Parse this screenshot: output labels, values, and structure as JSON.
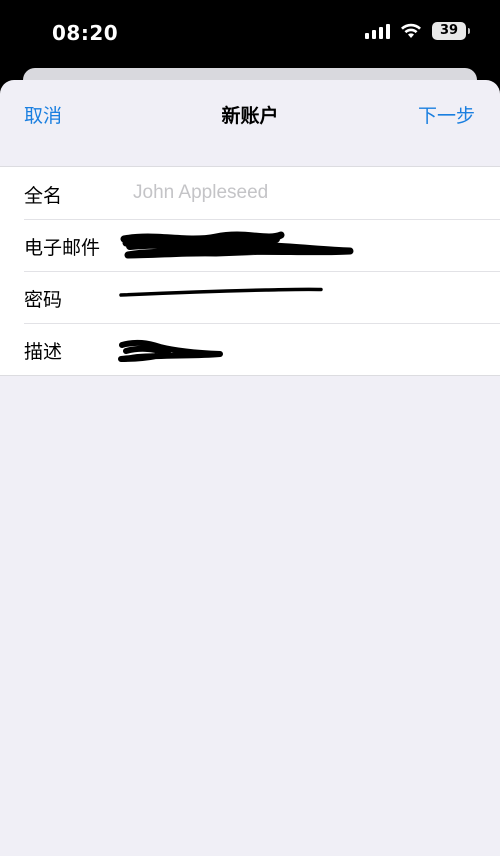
{
  "status_bar": {
    "time": "08:20",
    "battery": "39",
    "icons": [
      "signal-icon",
      "wifi-icon",
      "battery-icon"
    ]
  },
  "nav": {
    "cancel": "取消",
    "title": "新账户",
    "next": "下一步",
    "accent_color": "#1a7fe0"
  },
  "form": {
    "fields": [
      {
        "label": "全名",
        "placeholder": "John Appleseed",
        "value": ""
      },
      {
        "label": "电子邮件",
        "value": "(redacted)"
      },
      {
        "label": "密码",
        "value": "(redacted)"
      },
      {
        "label": "描述",
        "value": "(redacted)"
      }
    ]
  },
  "colors": {
    "background": "#f0eff6",
    "separator": "#e2e2e6"
  }
}
